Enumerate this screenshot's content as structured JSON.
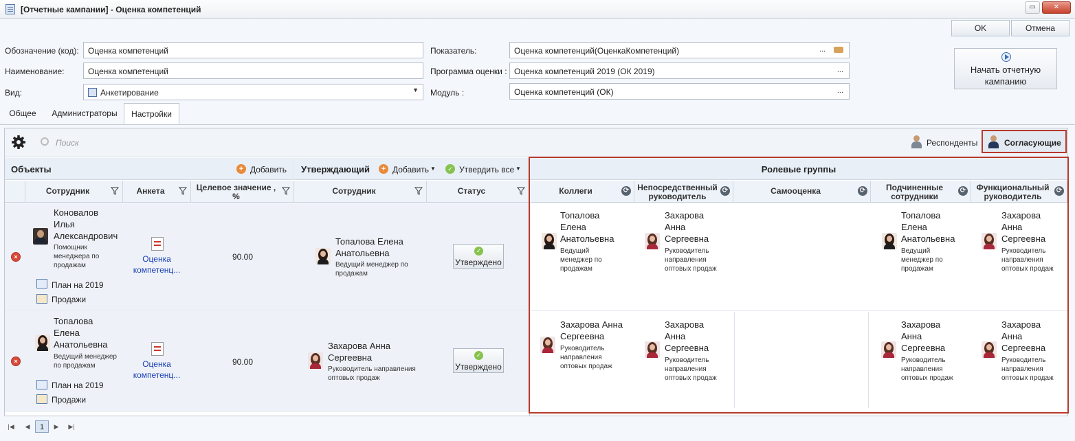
{
  "window": {
    "title": "[Отчетные кампании] - Оценка компетенций",
    "min_label": "▭",
    "close_label": "✕"
  },
  "actions": {
    "ok": "OK",
    "cancel": "Отмена",
    "start_campaign_line1": "Начать отчетную",
    "start_campaign_line2": "кампанию"
  },
  "form": {
    "code_label": "Обозначение (код):",
    "code_value": "Оценка компетенций",
    "name_label": "Наименование:",
    "name_value": "Оценка компетенций",
    "type_label": "Вид:",
    "type_value": "Анкетирование",
    "indicator_label": "Показатель:",
    "indicator_value": "Оценка компетенций(ОценкаКомпетенций)",
    "program_label": "Программа оценки :",
    "program_value": "Оценка компетенций 2019 (ОК 2019)",
    "module_label": "Модуль :",
    "module_value": "Оценка компетенций (ОК)",
    "dots": "..."
  },
  "tabs": [
    {
      "label": "Общее"
    },
    {
      "label": "Администраторы"
    },
    {
      "label": "Настройки",
      "active": true
    }
  ],
  "toolbar": {
    "search_placeholder": "Поиск",
    "respondents": "Респонденты",
    "approvers": "Согласующие"
  },
  "sections": {
    "objects": "Объекты",
    "add": "Добавить",
    "approver": "Утверждающий",
    "approve_all": "Утвердить все",
    "role_groups": "Ролевые группы"
  },
  "columns": {
    "employee": "Сотрудник",
    "survey": "Анкета",
    "target_line1": "Целевое значение ,",
    "target_line2": "%",
    "approver_employee": "Сотрудник",
    "status": "Статус",
    "colleagues": "Коллеги",
    "direct_mgr_line1": "Непосредственный",
    "direct_mgr_line2": "руководитель",
    "self": "Самооценка",
    "subordinates_line1": "Подчиненные",
    "subordinates_line2": "сотрудники",
    "functional_line1": "Функциональный",
    "functional_line2": "руководитель"
  },
  "rows": [
    {
      "employee": {
        "name1": "Коновалов",
        "name2": "Илья",
        "name3": "Александрович",
        "role1": "Помощник",
        "role2": "менеджера по",
        "role3": "продажам"
      },
      "plan": "План на 2019",
      "sales": "Продажи",
      "survey1": "Оценка",
      "survey2": "компетенц...",
      "target": "90.00",
      "approver": {
        "name1": "Топалова Елена",
        "name2": "Анатольевна",
        "role1": "Ведущий менеджер по",
        "role2": "продажам"
      },
      "status": "Утверждено",
      "colleague": {
        "name1": "Топалова",
        "name2": "Елена",
        "name3": "Анатольевна",
        "role1": "Ведущий",
        "role2": "менеджер по",
        "role3": "продажам"
      },
      "direct": {
        "name1": "Захарова",
        "name2": "Анна",
        "name3": "Сергеевна",
        "role1": "Руководитель",
        "role2": "направления",
        "role3": "оптовых продаж"
      },
      "subordinate": {
        "name1": "Топалова",
        "name2": "Елена",
        "name3": "Анатольевна",
        "role1": "Ведущий",
        "role2": "менеджер по",
        "role3": "продажам"
      },
      "functional": {
        "name1": "Захарова",
        "name2": "Анна",
        "name3": "Сергеевна",
        "role1": "Руководитель",
        "role2": "направления",
        "role3": "оптовых продаж"
      }
    },
    {
      "employee": {
        "name1": "Топалова",
        "name2": "Елена",
        "name3": "Анатольевна",
        "role1": "Ведущий менеджер",
        "role2": "по продажам"
      },
      "plan": "План на 2019",
      "sales": "Продажи",
      "survey1": "Оценка",
      "survey2": "компетенц...",
      "target": "90.00",
      "approver": {
        "name1": "Захарова Анна",
        "name2": "Сергеевна",
        "role1": "Руководитель направления",
        "role2": "оптовых продаж"
      },
      "status": "Утверждено",
      "colleague": {
        "name1": "Захарова Анна",
        "name2": "Сергеевна",
        "role1": "Руководитель",
        "role2": "направления",
        "role3": "оптовых продаж"
      },
      "direct": {
        "name1": "Захарова",
        "name2": "Анна",
        "name3": "Сергеевна",
        "role1": "Руководитель",
        "role2": "направления",
        "role3": "оптовых продаж"
      },
      "subordinate": {
        "name1": "Захарова",
        "name2": "Анна",
        "name3": "Сергеевна",
        "role1": "Руководитель",
        "role2": "направления",
        "role3": "оптовых продаж"
      },
      "functional": {
        "name1": "Захарова",
        "name2": "Анна",
        "name3": "Сергеевна",
        "role1": "Руководитель",
        "role2": "направления",
        "role3": "оптовых продаж"
      }
    }
  ],
  "pager": {
    "current_page": "1"
  },
  "colors": {
    "accent_red": "#b8392b",
    "link_blue": "#1a3fb5",
    "status_green": "#86c34d"
  }
}
